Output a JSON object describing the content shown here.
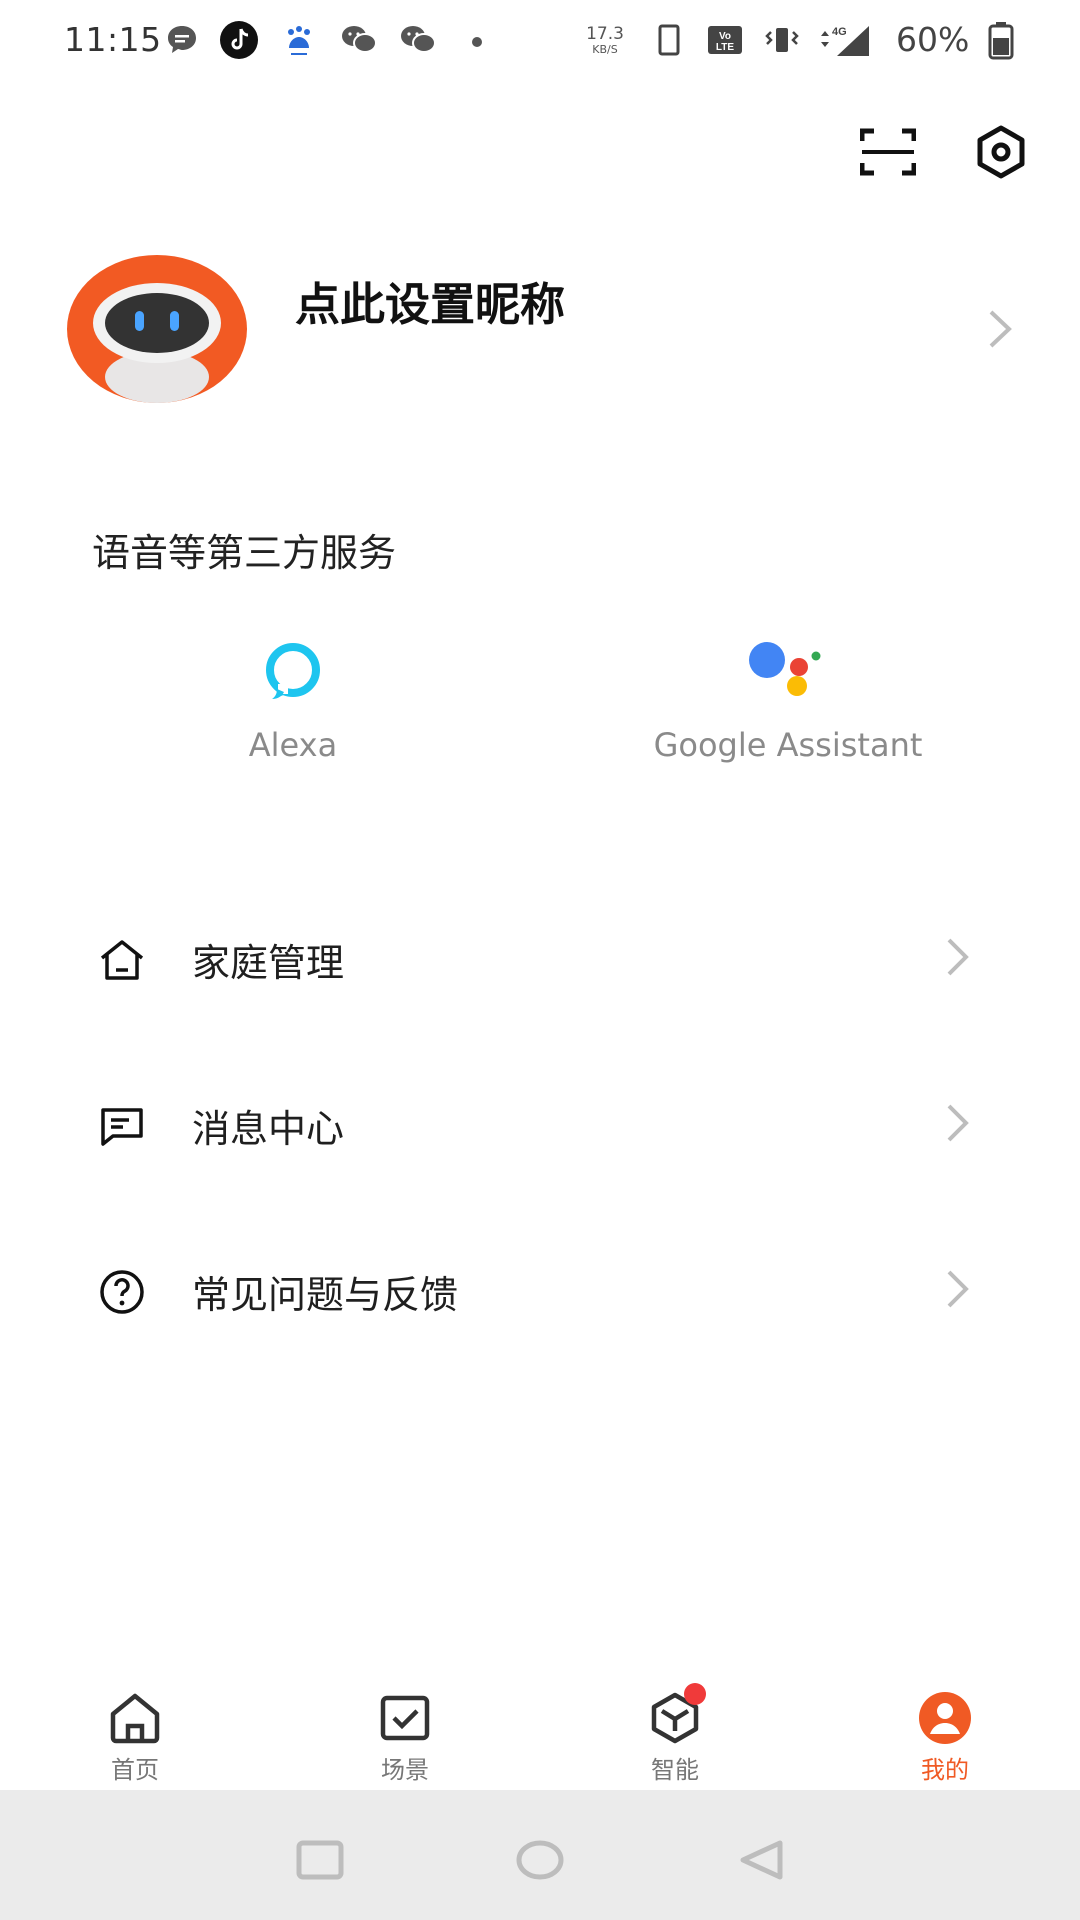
{
  "status_bar": {
    "time": "11:15",
    "net_speed_value": "17.3",
    "net_speed_unit": "KB/S",
    "battery": "60%",
    "icons": [
      "message-icon",
      "tiktok-icon",
      "baidu-icon",
      "wechat-icon",
      "wechat-icon",
      "dot-icon",
      "phone-icon",
      "volte-icon",
      "vibrate-icon",
      "signal-4g-icon",
      "battery-icon"
    ]
  },
  "top_actions": {
    "icons": [
      "scan-icon",
      "settings-icon"
    ]
  },
  "profile": {
    "nickname": "点此设置昵称",
    "avatar_icon": "robot-avatar"
  },
  "third_party": {
    "title": "语音等第三方服务",
    "services": [
      {
        "label": "Alexa",
        "icon": "alexa-icon",
        "color": "#1ec5ef"
      },
      {
        "label": "Google Assistant",
        "icon": "google-assistant-icon"
      }
    ]
  },
  "menu": [
    {
      "label": "家庭管理",
      "icon": "home-outline-icon"
    },
    {
      "label": "消息中心",
      "icon": "message-outline-icon"
    },
    {
      "label": "常见问题与反馈",
      "icon": "help-circle-icon"
    }
  ],
  "bottom_nav": {
    "tabs": [
      {
        "label": "首页",
        "icon": "home-icon"
      },
      {
        "label": "场景",
        "icon": "scene-icon"
      },
      {
        "label": "智能",
        "icon": "smart-cube-icon",
        "badge": true
      },
      {
        "label": "我的",
        "icon": "profile-icon",
        "active": true
      }
    ]
  },
  "colors": {
    "accent": "#f05a24",
    "badge": "#f03a3a",
    "chevron": "#bdbdbd"
  }
}
